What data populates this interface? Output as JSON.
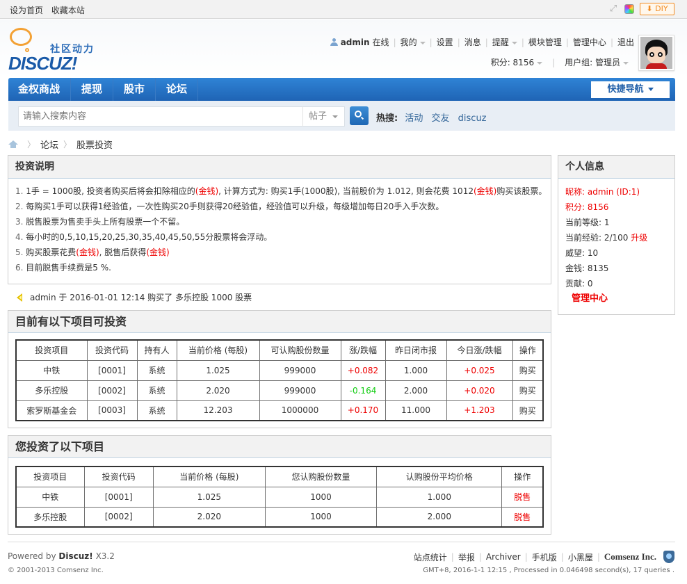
{
  "topbar": {
    "links": [
      "设为首页",
      "收藏本站"
    ],
    "diy_label": "DIY"
  },
  "header": {
    "logo_cn": "社区动力",
    "logo_en": "DISCUZ!",
    "user": {
      "name": "admin",
      "status": "在线",
      "menu": [
        "我的",
        "设置",
        "消息",
        "提醒",
        "模块管理",
        "管理中心",
        "退出"
      ]
    },
    "credits_label": "积分: 8156",
    "usergroup_label": "用户组: 管理员"
  },
  "nav": {
    "items": [
      "金权商战",
      "提现",
      "股市",
      "论坛"
    ],
    "quick_nav": "快捷导航"
  },
  "search": {
    "placeholder": "请输入搜索内容",
    "type": "帖子",
    "hot_label": "热搜:",
    "hot_terms": [
      "活动",
      "交友",
      "discuz"
    ]
  },
  "breadcrumb": [
    "论坛",
    "股票投资"
  ],
  "intro": {
    "title": "投资说明",
    "lines": [
      {
        "num": "1.",
        "parts": [
          "1手 = 1000股, 投资者购买后将会扣除相应的",
          "(金钱)",
          ", 计算方式为: 购买1手(1000股), 当前股价为 1.012, 则会花费 1012",
          "(金钱)",
          "购买该股票。"
        ]
      },
      {
        "num": "2.",
        "parts": [
          "每购买1手可以获得1经验值，一次性购买20手则获得20经验值，经验值可以升级，每级增加每日20手入手次数。"
        ]
      },
      {
        "num": "3.",
        "parts": [
          "脱售股票为售卖手头上所有股票一个不留。"
        ]
      },
      {
        "num": "4.",
        "parts": [
          "每小时的0,5,10,15,20,25,30,35,40,45,50,55分股票将会浮动。"
        ]
      },
      {
        "num": "5.",
        "parts": [
          "购买股票花费",
          "(金钱)",
          ", 脱售后获得",
          "(金钱)"
        ]
      },
      {
        "num": "6.",
        "parts": [
          "目前脱售手续费是5 %."
        ]
      }
    ]
  },
  "ticker": "admin 于 2016-01-01 12:14 购买了 多乐控股 1000 股票",
  "profile": {
    "title": "个人信息",
    "nickname": "昵称: admin (ID:1)",
    "credits": "积分: 8156",
    "level": "当前等级: 1",
    "exp": "当前经验: 2/100",
    "upgrade": "升级",
    "prestige": "威望: 10",
    "money": "金钱: 8135",
    "contrib": "贡献: 0",
    "admin_link": "管理中心"
  },
  "available": {
    "title": "目前有以下项目可投资",
    "headers": [
      "投资项目",
      "投资代码",
      "持有人",
      "当前价格 (每股)",
      "可认购股份数量",
      "涨/跌幅",
      "昨日闭市报",
      "今日涨/跌幅",
      "操作"
    ],
    "rows": [
      [
        "中铁",
        "[0001]",
        "系统",
        "1.025",
        "999000",
        "+0.082",
        "1.000",
        "+0.025",
        "购买"
      ],
      [
        "多乐控股",
        "[0002]",
        "系统",
        "2.020",
        "999000",
        "-0.164",
        "2.000",
        "+0.020",
        "购买"
      ],
      [
        "索罗斯基金会",
        "[0003]",
        "系统",
        "12.203",
        "1000000",
        "+0.170",
        "11.000",
        "+1.203",
        "购买"
      ]
    ]
  },
  "mine": {
    "title": "您投资了以下项目",
    "headers": [
      "投资项目",
      "投资代码",
      "当前价格 (每股)",
      "您认购股份数量",
      "认购股份平均价格",
      "操作"
    ],
    "rows": [
      [
        "中铁",
        "[0001]",
        "1.025",
        "1000",
        "1.000",
        "脱售"
      ],
      [
        "多乐控股",
        "[0002]",
        "2.020",
        "1000",
        "2.000",
        "脱售"
      ]
    ]
  },
  "footer": {
    "powered_prefix": "Powered by",
    "powered_brand": "Discuz!",
    "powered_version": "X3.2",
    "copyright": "© 2001-2013 Comsenz Inc.",
    "links": [
      "站点统计",
      "举报",
      "Archiver",
      "手机版",
      "小黑屋"
    ],
    "company": "Comsenz Inc.",
    "gmt": "GMT+8, 2016-1-1 12:15 , Processed in 0.046498 second(s), 17 queries ."
  },
  "colors": {
    "accent": "#1f64b5",
    "up": "#ee0000",
    "down": "#11cc11",
    "diy": "#f28b22"
  }
}
